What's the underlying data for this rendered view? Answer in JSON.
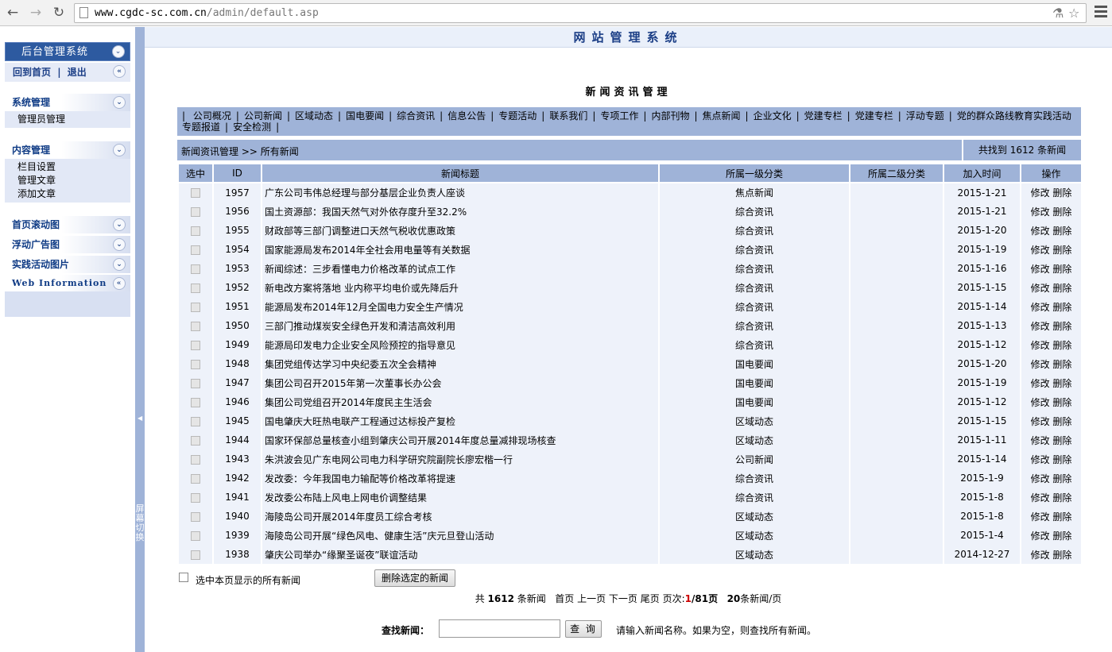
{
  "browser": {
    "url_host": "www.cgdc-sc.com.cn",
    "url_path": "/admin/default.asp"
  },
  "sidebar": {
    "title": "后台管理系统",
    "home_link": "回到首页",
    "logout_link": "退出",
    "groups": [
      {
        "label": "系统管理",
        "items": [
          "管理员管理"
        ]
      },
      {
        "label": "内容管理",
        "items": [
          "栏目设置",
          "管理文章",
          "添加文章"
        ]
      },
      {
        "label": "首页滚动图",
        "items": []
      },
      {
        "label": "浮动广告图",
        "items": []
      },
      {
        "label": "实践活动图片",
        "items": []
      },
      {
        "label": "Web Information",
        "items": []
      }
    ],
    "splitter_label": "屏幕切换"
  },
  "main": {
    "site_title": "网站管理系统",
    "page_title": "新闻资讯管理",
    "categories": [
      "公司概况",
      "公司新闻",
      "区域动态",
      "国电要闻",
      "综合资讯",
      "信息公告",
      "专题活动",
      "联系我们",
      "专项工作",
      "内部刊物",
      "焦点新闻",
      "企业文化",
      "党建专栏",
      "党建专栏",
      "浮动专题",
      "党的群众路线教育实践活动专题报道",
      "安全检测"
    ],
    "breadcrumb": "新闻资讯管理 >> 所有新闻",
    "found_text": "共找到 1612 条新闻",
    "columns": [
      "选中",
      "ID",
      "新闻标题",
      "所属一级分类",
      "所属二级分类",
      "加入时间",
      "操作"
    ],
    "edit_label": "修改",
    "delete_label": "删除",
    "rows": [
      {
        "id": "1957",
        "title": "广东公司韦伟总经理与部分基层企业负责人座谈",
        "cat1": "焦点新闻",
        "cat2": "",
        "date": "2015-1-21"
      },
      {
        "id": "1956",
        "title": "国土资源部：我国天然气对外依存度升至32.2%",
        "cat1": "综合资讯",
        "cat2": "",
        "date": "2015-1-21"
      },
      {
        "id": "1955",
        "title": "财政部等三部门调整进口天然气税收优惠政策",
        "cat1": "综合资讯",
        "cat2": "",
        "date": "2015-1-20"
      },
      {
        "id": "1954",
        "title": "国家能源局发布2014年全社会用电量等有关数据",
        "cat1": "综合资讯",
        "cat2": "",
        "date": "2015-1-19"
      },
      {
        "id": "1953",
        "title": "新闻综述：三步看懂电力价格改革的试点工作",
        "cat1": "综合资讯",
        "cat2": "",
        "date": "2015-1-16"
      },
      {
        "id": "1952",
        "title": "新电改方案将落地  业内称平均电价或先降后升",
        "cat1": "综合资讯",
        "cat2": "",
        "date": "2015-1-15"
      },
      {
        "id": "1951",
        "title": "能源局发布2014年12月全国电力安全生产情况",
        "cat1": "综合资讯",
        "cat2": "",
        "date": "2015-1-14"
      },
      {
        "id": "1950",
        "title": "三部门推动煤炭安全绿色开发和清洁高效利用",
        "cat1": "综合资讯",
        "cat2": "",
        "date": "2015-1-13"
      },
      {
        "id": "1949",
        "title": "能源局印发电力企业安全风险预控的指导意见",
        "cat1": "综合资讯",
        "cat2": "",
        "date": "2015-1-12"
      },
      {
        "id": "1948",
        "title": "集团党组传达学习中央纪委五次全会精神",
        "cat1": "国电要闻",
        "cat2": "",
        "date": "2015-1-20"
      },
      {
        "id": "1947",
        "title": "集团公司召开2015年第一次董事长办公会",
        "cat1": "国电要闻",
        "cat2": "",
        "date": "2015-1-19"
      },
      {
        "id": "1946",
        "title": "集团公司党组召开2014年度民主生活会",
        "cat1": "国电要闻",
        "cat2": "",
        "date": "2015-1-12"
      },
      {
        "id": "1945",
        "title": "国电肇庆大旺热电联产工程通过达标投产复检",
        "cat1": "区域动态",
        "cat2": "",
        "date": "2015-1-15"
      },
      {
        "id": "1944",
        "title": "国家环保部总量核查小组到肇庆公司开展2014年度总量减排现场核查",
        "cat1": "区域动态",
        "cat2": "",
        "date": "2015-1-11"
      },
      {
        "id": "1943",
        "title": "朱洪波会见广东电网公司电力科学研究院副院长廖宏楷一行",
        "cat1": "公司新闻",
        "cat2": "",
        "date": "2015-1-14"
      },
      {
        "id": "1942",
        "title": "发改委：今年我国电力输配等价格改革将提速",
        "cat1": "综合资讯",
        "cat2": "",
        "date": "2015-1-9"
      },
      {
        "id": "1941",
        "title": "发改委公布陆上风电上网电价调整结果",
        "cat1": "综合资讯",
        "cat2": "",
        "date": "2015-1-8"
      },
      {
        "id": "1940",
        "title": "海陵岛公司开展2014年度员工综合考核",
        "cat1": "区域动态",
        "cat2": "",
        "date": "2015-1-8"
      },
      {
        "id": "1939",
        "title": "海陵岛公司开展“绿色风电、健康生活”庆元旦登山活动",
        "cat1": "区域动态",
        "cat2": "",
        "date": "2015-1-4"
      },
      {
        "id": "1938",
        "title": "肇庆公司举办“缘聚圣诞夜”联谊活动",
        "cat1": "区域动态",
        "cat2": "",
        "date": "2014-12-27"
      }
    ],
    "select_all_label": "选中本页显示的所有新闻",
    "delete_selected_label": "删除选定的新闻",
    "pager": {
      "total_prefix": "共",
      "total": "1612",
      "total_suffix": "条新闻",
      "first": "首页",
      "prev": "上一页",
      "next": "下一页",
      "last": "尾页",
      "page_label": "页次:",
      "current": "1",
      "page_total": "/81页",
      "per_page": "20",
      "per_page_suffix": "条新闻/页"
    },
    "search": {
      "label": "查找新闻：",
      "button": "查 询",
      "value": "",
      "hint": "请输入新闻名称。如果为空，则查找所有新闻。"
    }
  }
}
